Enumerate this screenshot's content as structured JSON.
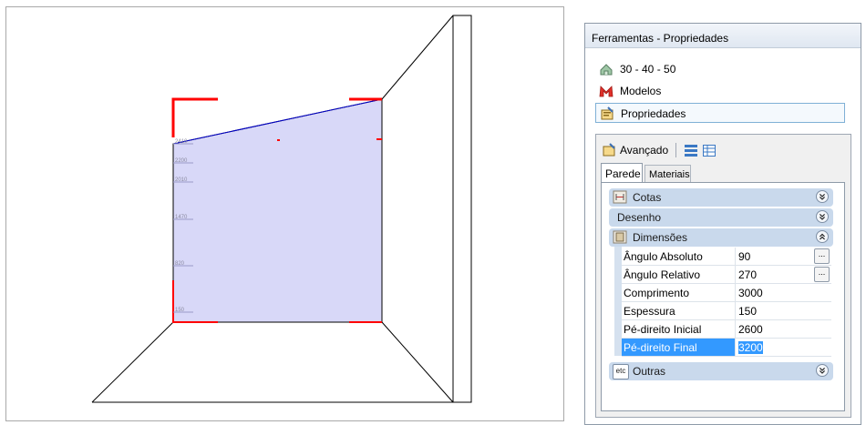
{
  "panel": {
    "title": "Ferramentas - Propriedades",
    "nav": [
      {
        "label": "30 - 40 - 50",
        "icon": "house-icon"
      },
      {
        "label": "Modelos",
        "icon": "models-icon"
      },
      {
        "label": "Propriedades",
        "icon": "properties-icon",
        "selected": true
      }
    ],
    "advanced_label": "Avançado",
    "tabs": [
      {
        "label": "Parede",
        "active": true
      },
      {
        "label": "Materiais",
        "active": false
      }
    ],
    "sections": {
      "cotas": {
        "label": "Cotas",
        "state": "collapsed"
      },
      "desenho": {
        "label": "Desenho",
        "state": "collapsed"
      },
      "dimensoes": {
        "label": "Dimensões",
        "state": "expanded"
      },
      "outras": {
        "label": "Outras",
        "state": "collapsed",
        "icon_text": "etc"
      }
    },
    "properties": [
      {
        "name": "Ângulo Absoluto",
        "value": "90",
        "has_button": true
      },
      {
        "name": "Ângulo Relativo",
        "value": "270",
        "has_button": true
      },
      {
        "name": "Comprimento",
        "value": "3000"
      },
      {
        "name": "Espessura",
        "value": "150"
      },
      {
        "name": "Pé-direito Inicial",
        "value": "2600"
      },
      {
        "name": "Pé-direito Final",
        "value": "3200",
        "selected": true
      }
    ],
    "ellipsis": "..."
  },
  "viewport": {
    "wall_fill": "#d8d8f8",
    "highlight_color": "#ff0000",
    "slope_line_color": "#0000cc",
    "ruler_labels": [
      "2410",
      "2200",
      "2010",
      "1470",
      "820",
      "150"
    ]
  }
}
